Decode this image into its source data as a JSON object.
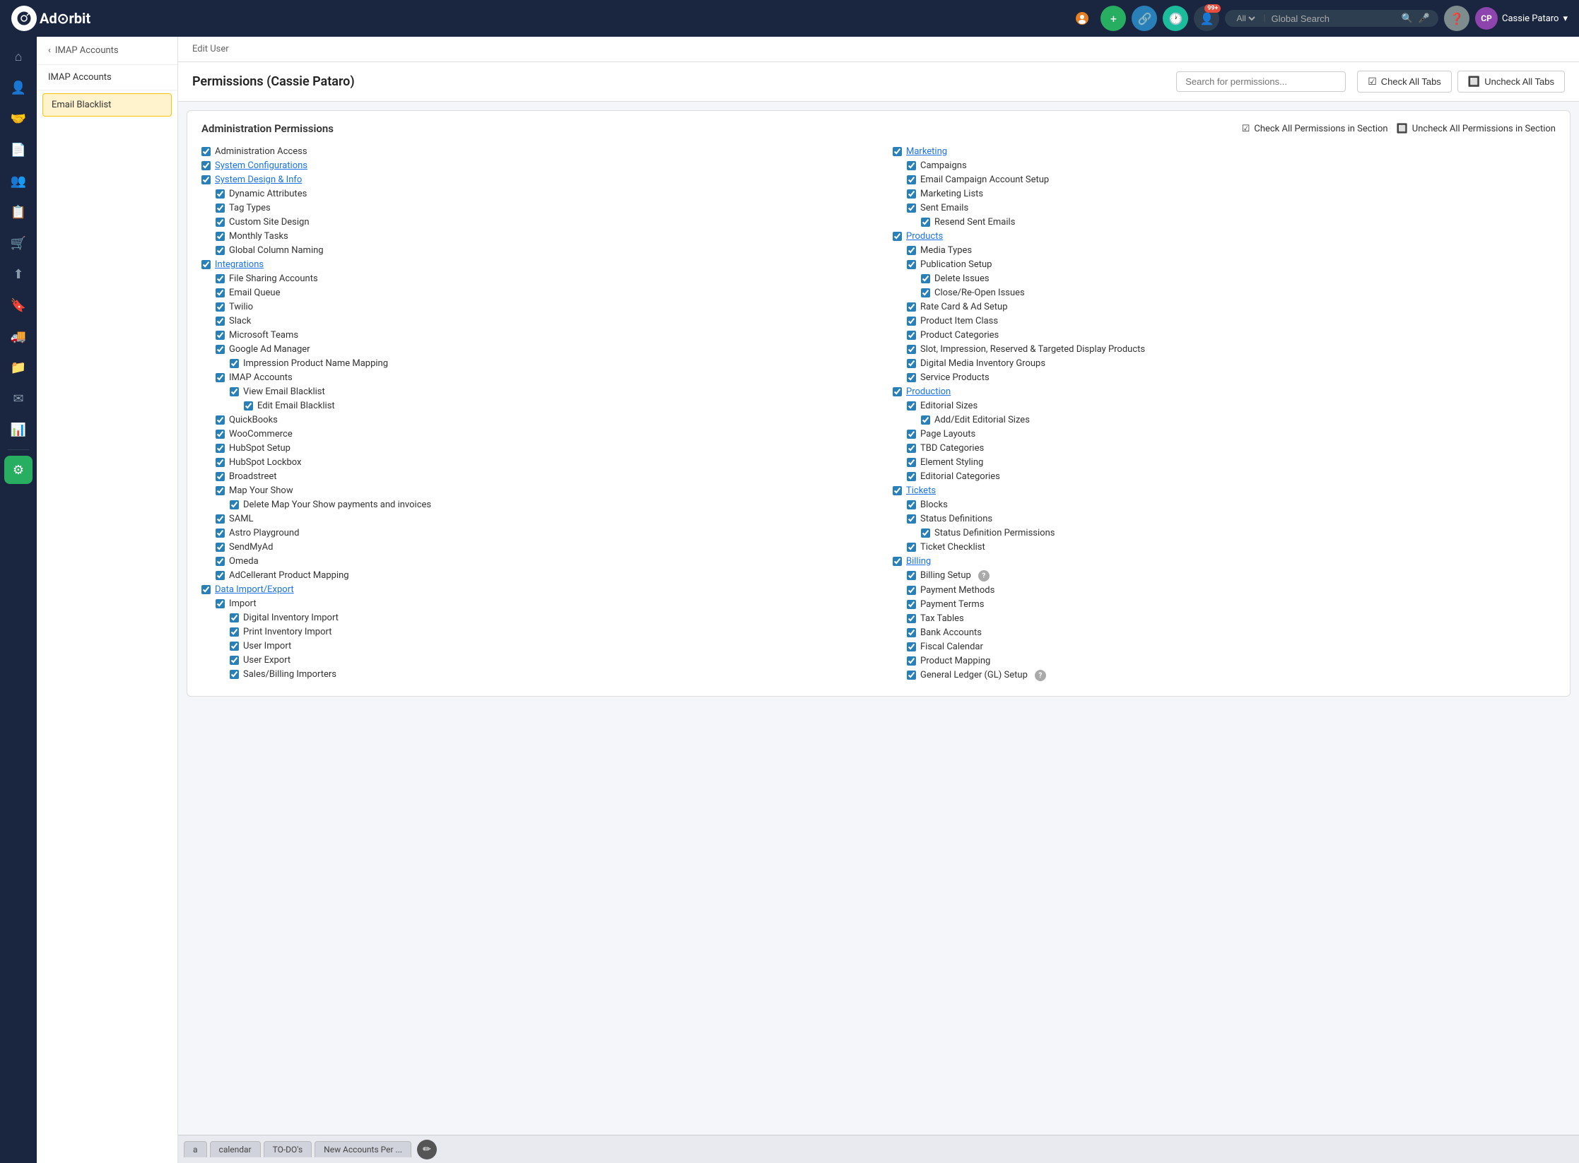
{
  "navbar": {
    "logo_text": "Ad⊙rbit",
    "search_placeholder": "Global Search",
    "search_option": "All",
    "user_name": "Cassie Pataro",
    "user_initials": "CP",
    "badge_count": "99+"
  },
  "sidebar": {
    "items": [
      {
        "name": "home",
        "icon": "⌂",
        "label": "Home"
      },
      {
        "name": "contacts",
        "icon": "👤",
        "label": "Contacts"
      },
      {
        "name": "handshake",
        "icon": "🤝",
        "label": "Deals"
      },
      {
        "name": "document",
        "icon": "📄",
        "label": "Documents"
      },
      {
        "name": "people",
        "icon": "👥",
        "label": "People"
      },
      {
        "name": "clipboard",
        "icon": "📋",
        "label": "Clipboard"
      },
      {
        "name": "cart",
        "icon": "🛒",
        "label": "Cart"
      },
      {
        "name": "upload",
        "icon": "⬆",
        "label": "Upload"
      },
      {
        "name": "bookmark",
        "icon": "🔖",
        "label": "Bookmark"
      },
      {
        "name": "truck",
        "icon": "🚚",
        "label": "Truck"
      },
      {
        "name": "file",
        "icon": "📁",
        "label": "File"
      },
      {
        "name": "email",
        "icon": "✉",
        "label": "Email"
      },
      {
        "name": "chart",
        "icon": "📊",
        "label": "Chart"
      },
      {
        "name": "settings",
        "icon": "⚙",
        "label": "Settings"
      }
    ]
  },
  "dropdown": {
    "back_label": "IMAP Accounts",
    "items": [
      {
        "label": "IMAP Accounts",
        "selected": false
      },
      {
        "label": "Email Blacklist",
        "selected": true
      }
    ]
  },
  "page": {
    "breadcrumb_edit": "Edit User",
    "user_title": "Permissions (Cassie Pataro)",
    "search_permissions_placeholder": "Search for permissions...",
    "check_all_tabs_label": "Check All Tabs",
    "uncheck_all_tabs_label": "Uncheck All Tabs",
    "check_all_section_label": "Check All Permissions in Section",
    "uncheck_all_section_label": "Uncheck All Permissions in Section",
    "admin_permissions_title": "Administration Permissions"
  },
  "permissions": {
    "left_column": [
      {
        "label": "Administration Access",
        "indent": 0,
        "checked": true,
        "link": false
      },
      {
        "label": "System Configurations",
        "indent": 0,
        "checked": true,
        "link": true
      },
      {
        "label": "System Design & Info",
        "indent": 0,
        "checked": true,
        "link": true
      },
      {
        "label": "Dynamic Attributes",
        "indent": 1,
        "checked": true,
        "link": false
      },
      {
        "label": "Tag Types",
        "indent": 1,
        "checked": true,
        "link": false
      },
      {
        "label": "Custom Site Design",
        "indent": 1,
        "checked": true,
        "link": false
      },
      {
        "label": "Monthly Tasks",
        "indent": 1,
        "checked": true,
        "link": false
      },
      {
        "label": "Global Column Naming",
        "indent": 1,
        "checked": true,
        "link": false
      },
      {
        "label": "Integrations",
        "indent": 0,
        "checked": true,
        "link": true
      },
      {
        "label": "File Sharing Accounts",
        "indent": 1,
        "checked": true,
        "link": false
      },
      {
        "label": "Email Queue",
        "indent": 1,
        "checked": true,
        "link": false
      },
      {
        "label": "Twilio",
        "indent": 1,
        "checked": true,
        "link": false
      },
      {
        "label": "Slack",
        "indent": 1,
        "checked": true,
        "link": false
      },
      {
        "label": "Microsoft Teams",
        "indent": 1,
        "checked": true,
        "link": false
      },
      {
        "label": "Google Ad Manager",
        "indent": 1,
        "checked": true,
        "link": false
      },
      {
        "label": "Impression Product Name Mapping",
        "indent": 2,
        "checked": true,
        "link": false
      },
      {
        "label": "IMAP Accounts",
        "indent": 1,
        "checked": true,
        "link": false
      },
      {
        "label": "View Email Blacklist",
        "indent": 2,
        "checked": true,
        "link": false
      },
      {
        "label": "Edit Email Blacklist",
        "indent": 3,
        "checked": true,
        "link": false
      },
      {
        "label": "QuickBooks",
        "indent": 1,
        "checked": true,
        "link": false
      },
      {
        "label": "WooCommerce",
        "indent": 1,
        "checked": true,
        "link": false
      },
      {
        "label": "HubSpot Setup",
        "indent": 1,
        "checked": true,
        "link": false
      },
      {
        "label": "HubSpot Lockbox",
        "indent": 1,
        "checked": true,
        "link": false
      },
      {
        "label": "Broadstreet",
        "indent": 1,
        "checked": true,
        "link": false
      },
      {
        "label": "Map Your Show",
        "indent": 1,
        "checked": true,
        "link": false
      },
      {
        "label": "Delete Map Your Show payments and invoices",
        "indent": 2,
        "checked": true,
        "link": false
      },
      {
        "label": "SAML",
        "indent": 1,
        "checked": true,
        "link": false
      },
      {
        "label": "Astro Playground",
        "indent": 1,
        "checked": true,
        "link": false
      },
      {
        "label": "SendMyAd",
        "indent": 1,
        "checked": true,
        "link": false
      },
      {
        "label": "Omeda",
        "indent": 1,
        "checked": true,
        "link": false
      },
      {
        "label": "AdCellerant Product Mapping",
        "indent": 1,
        "checked": true,
        "link": false
      },
      {
        "label": "Data Import/Export",
        "indent": 0,
        "checked": true,
        "link": true
      },
      {
        "label": "Import",
        "indent": 1,
        "checked": true,
        "link": false
      },
      {
        "label": "Digital Inventory Import",
        "indent": 2,
        "checked": true,
        "link": false
      },
      {
        "label": "Print Inventory Import",
        "indent": 2,
        "checked": true,
        "link": false
      },
      {
        "label": "User Import",
        "indent": 2,
        "checked": true,
        "link": false
      },
      {
        "label": "User Export",
        "indent": 2,
        "checked": true,
        "link": false
      },
      {
        "label": "Sales/Billing Importers",
        "indent": 2,
        "checked": true,
        "link": false
      }
    ],
    "right_column": [
      {
        "label": "Marketing",
        "indent": 0,
        "checked": true,
        "link": true
      },
      {
        "label": "Campaigns",
        "indent": 1,
        "checked": true,
        "link": false
      },
      {
        "label": "Email Campaign Account Setup",
        "indent": 1,
        "checked": true,
        "link": false
      },
      {
        "label": "Marketing Lists",
        "indent": 1,
        "checked": true,
        "link": false
      },
      {
        "label": "Sent Emails",
        "indent": 1,
        "checked": true,
        "link": false
      },
      {
        "label": "Resend Sent Emails",
        "indent": 2,
        "checked": true,
        "link": false
      },
      {
        "label": "Products",
        "indent": 0,
        "checked": true,
        "link": true
      },
      {
        "label": "Media Types",
        "indent": 1,
        "checked": true,
        "link": false
      },
      {
        "label": "Publication Setup",
        "indent": 1,
        "checked": true,
        "link": false
      },
      {
        "label": "Delete Issues",
        "indent": 2,
        "checked": true,
        "link": false
      },
      {
        "label": "Close/Re-Open Issues",
        "indent": 2,
        "checked": true,
        "link": false
      },
      {
        "label": "Rate Card & Ad Setup",
        "indent": 1,
        "checked": true,
        "link": false
      },
      {
        "label": "Product Item Class",
        "indent": 1,
        "checked": true,
        "link": false
      },
      {
        "label": "Product Categories",
        "indent": 1,
        "checked": true,
        "link": false
      },
      {
        "label": "Slot, Impression, Reserved & Targeted Display Products",
        "indent": 1,
        "checked": true,
        "link": false
      },
      {
        "label": "Digital Media Inventory Groups",
        "indent": 1,
        "checked": true,
        "link": false
      },
      {
        "label": "Service Products",
        "indent": 1,
        "checked": true,
        "link": false
      },
      {
        "label": "Production",
        "indent": 0,
        "checked": true,
        "link": true
      },
      {
        "label": "Editorial Sizes",
        "indent": 1,
        "checked": true,
        "link": false
      },
      {
        "label": "Add/Edit Editorial Sizes",
        "indent": 2,
        "checked": true,
        "link": false
      },
      {
        "label": "Page Layouts",
        "indent": 1,
        "checked": true,
        "link": false
      },
      {
        "label": "TBD Categories",
        "indent": 1,
        "checked": true,
        "link": false
      },
      {
        "label": "Element Styling",
        "indent": 1,
        "checked": true,
        "link": false
      },
      {
        "label": "Editorial Categories",
        "indent": 1,
        "checked": true,
        "link": false
      },
      {
        "label": "Tickets",
        "indent": 0,
        "checked": true,
        "link": true
      },
      {
        "label": "Blocks",
        "indent": 1,
        "checked": true,
        "link": false
      },
      {
        "label": "Status Definitions",
        "indent": 1,
        "checked": true,
        "link": false
      },
      {
        "label": "Status Definition Permissions",
        "indent": 2,
        "checked": true,
        "link": false
      },
      {
        "label": "Ticket Checklist",
        "indent": 1,
        "checked": true,
        "link": false
      },
      {
        "label": "Billing",
        "indent": 0,
        "checked": true,
        "link": true
      },
      {
        "label": "Billing Setup",
        "indent": 1,
        "checked": true,
        "link": false,
        "help": true
      },
      {
        "label": "Payment Methods",
        "indent": 1,
        "checked": true,
        "link": false
      },
      {
        "label": "Payment Terms",
        "indent": 1,
        "checked": true,
        "link": false
      },
      {
        "label": "Tax Tables",
        "indent": 1,
        "checked": true,
        "link": false
      },
      {
        "label": "Bank Accounts",
        "indent": 1,
        "checked": true,
        "link": false
      },
      {
        "label": "Fiscal Calendar",
        "indent": 1,
        "checked": true,
        "link": false
      },
      {
        "label": "Product Mapping",
        "indent": 1,
        "checked": true,
        "link": false
      },
      {
        "label": "General Ledger (GL) Setup",
        "indent": 1,
        "checked": true,
        "link": false,
        "help": true
      }
    ]
  },
  "bottom_tabs": [
    {
      "label": "a",
      "active": false
    },
    {
      "label": "calendar",
      "active": false
    },
    {
      "label": "TO-DO's",
      "active": false
    },
    {
      "label": "New Accounts Per ...",
      "active": false
    }
  ]
}
